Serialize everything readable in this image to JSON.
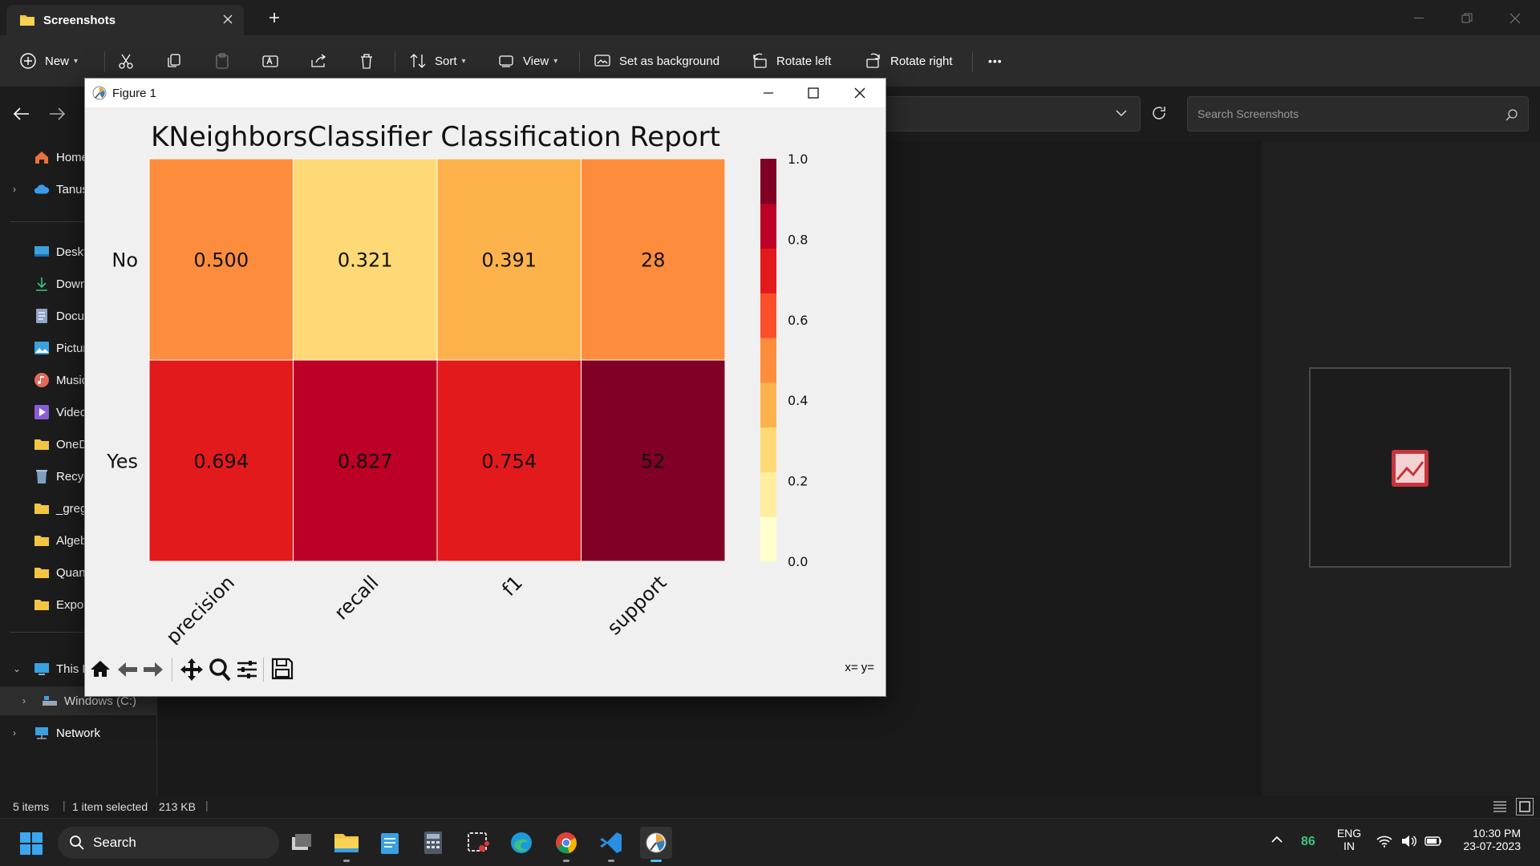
{
  "explorer": {
    "tab_title": "Screenshots",
    "toolbar": {
      "new": "New",
      "sort": "Sort",
      "view": "View",
      "set_bg": "Set as background",
      "rotate_left": "Rotate left",
      "rotate_right": "Rotate right",
      "more": "•••"
    },
    "search_placeholder": "Search Screenshots",
    "sidebar": {
      "items": [
        {
          "label": "Home",
          "icon": "home-icon"
        },
        {
          "label": "Tanus",
          "icon": "cloud-icon"
        },
        {
          "label": "Deskt",
          "icon": "desktop-icon"
        },
        {
          "label": "Down",
          "icon": "download-icon"
        },
        {
          "label": "Docu",
          "icon": "document-icon"
        },
        {
          "label": "Pictur",
          "icon": "pictures-icon"
        },
        {
          "label": "Music",
          "icon": "music-icon"
        },
        {
          "label": "Videc",
          "icon": "videos-icon"
        },
        {
          "label": "OneD",
          "icon": "folder-icon"
        },
        {
          "label": "Recyc",
          "icon": "recycle-bin-icon"
        },
        {
          "label": "_greg",
          "icon": "folder-icon"
        },
        {
          "label": "Algeb",
          "icon": "folder-icon"
        },
        {
          "label": "Quan",
          "icon": "folder-icon"
        },
        {
          "label": "Expor",
          "icon": "folder-icon"
        },
        {
          "label": "This P",
          "icon": "this-pc-icon"
        },
        {
          "label": "Windows (C:)",
          "icon": "drive-icon"
        },
        {
          "label": "Network",
          "icon": "network-icon"
        }
      ]
    },
    "status": {
      "items": "5 items",
      "selected": "1 item selected",
      "size": "213 KB"
    }
  },
  "figure": {
    "window_title": "Figure 1",
    "coords": "x= y=",
    "chart_data": {
      "type": "heatmap",
      "title": "KNeighborsClassifier Classification Report",
      "rows": [
        "No",
        "Yes"
      ],
      "columns": [
        "precision",
        "recall",
        "f1",
        "support"
      ],
      "values": [
        [
          0.5,
          0.321,
          0.391,
          28
        ],
        [
          0.694,
          0.827,
          0.754,
          52
        ]
      ],
      "cell_labels": [
        [
          "0.500",
          "0.321",
          "0.391",
          "28"
        ],
        [
          "0.694",
          "0.827",
          "0.754",
          "52"
        ]
      ],
      "colorbar": {
        "ticks": [
          "0.0",
          "0.2",
          "0.4",
          "0.6",
          "0.8",
          "1.0"
        ],
        "range": [
          0,
          1
        ],
        "steps": 9,
        "colormap": "YlOrRd"
      },
      "support_scaled": [
        0.538,
        1.0
      ]
    }
  },
  "taskbar": {
    "search": "Search",
    "tray_badge": "86",
    "lang1": "ENG",
    "lang2": "IN",
    "time": "10:30 PM",
    "date": "23-07-2023"
  }
}
